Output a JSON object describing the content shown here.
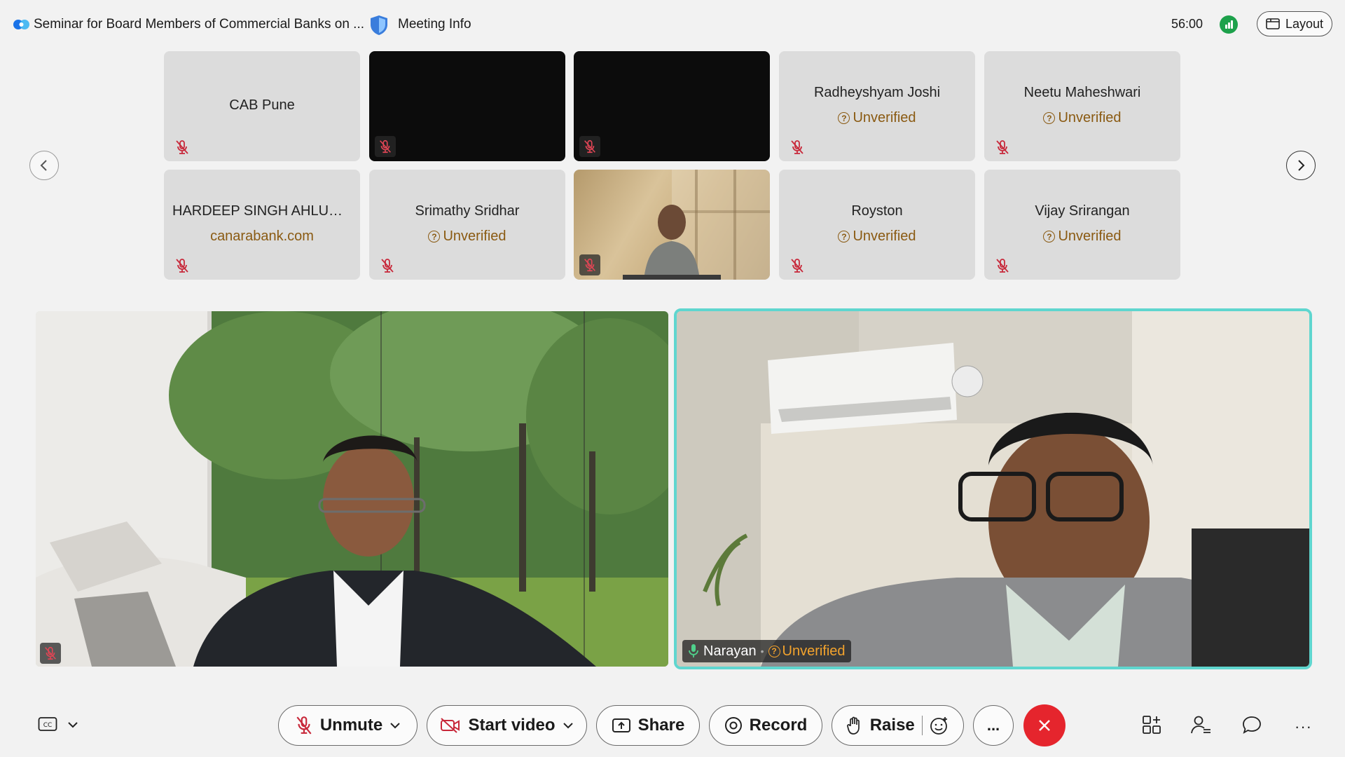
{
  "header": {
    "meeting_title": "Seminar for Board Members of Commercial Banks on ...",
    "meeting_info_label": "Meeting Info",
    "timer": "56:00",
    "layout_label": "Layout"
  },
  "participants_grid": [
    {
      "name": "CAB Pune",
      "subtitle": "",
      "video": "off"
    },
    {
      "name": "",
      "subtitle": "",
      "video": "dark"
    },
    {
      "name": "",
      "subtitle": "",
      "video": "dark"
    },
    {
      "name": "Radheyshyam Joshi",
      "subtitle": "Unverified",
      "video": "off"
    },
    {
      "name": "Neetu Maheshwari",
      "subtitle": "Unverified",
      "video": "off"
    },
    {
      "name": "HARDEEP SINGH AHLUW...",
      "subtitle": "canarabank.com",
      "video": "off"
    },
    {
      "name": "Srimathy Sridhar",
      "subtitle": "Unverified",
      "video": "off"
    },
    {
      "name": "",
      "subtitle": "",
      "video": "camera"
    },
    {
      "name": "Royston",
      "subtitle": "Unverified",
      "video": "off"
    },
    {
      "name": "Vijay Srirangan",
      "subtitle": "Unverified",
      "video": "off"
    }
  ],
  "stage": {
    "active_speaker_name": "Narayan",
    "active_speaker_status": "Unverified"
  },
  "controls": {
    "unmute_label": "Unmute",
    "start_video_label": "Start video",
    "share_label": "Share",
    "record_label": "Record",
    "raise_label": "Raise",
    "more_label": "..."
  },
  "colors": {
    "end_call": "#e5252d",
    "active_border": "#5fd6cf",
    "unverified": "#8a5a12",
    "mic_off": "#c8283a"
  }
}
